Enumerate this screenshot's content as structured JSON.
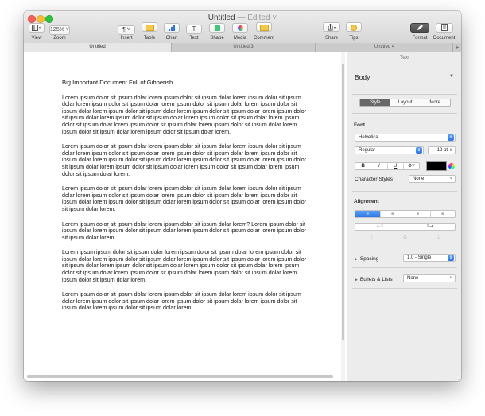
{
  "window": {
    "title": "Untitled",
    "edited_suffix": "— Edited ˅"
  },
  "toolbar": {
    "view_label": "View",
    "zoom_value": "125% ˅",
    "zoom_label": "Zoom",
    "insert_label": "Insert",
    "table_label": "Table",
    "chart_label": "Chart",
    "text_label": "Text",
    "shape_label": "Shape",
    "media_label": "Media",
    "comment_label": "Comment",
    "share_label": "Share",
    "tips_label": "Tips",
    "format_label": "Format",
    "document_label": "Document"
  },
  "tabs": [
    {
      "label": "Untitled"
    },
    {
      "label": "Untitled 3"
    },
    {
      "label": "Untitled 4"
    }
  ],
  "tab_add": "+",
  "document": {
    "heading": "Big Important Document Full of Gibberish",
    "paragraphs": [
      "Lorem ipsum dolor sit ipsum dolar lorem ipsum dolor sit ipsum dolar lorem ipsum dolor sit ipsum dolar lorem ipsum dolor sit ipsum dolar lorem ipsum dolor sit ipsum dolar lorem ipsum dolor sit ipsum dolar lorem ipsum dolor sit ipsum dolar lorem ipsum dolor sit ipsum dolar lorem ipsum dolor sit ipsum dolar lorem ipsum dolor sit ipsum dolar lorem ipsum dolor sit ipsum dolar lorem ipsum dolor sit ipsum dolar lorem ipsum dolor sit ipsum dolar lorem ipsum dolor sit ipsum dolar lorem ipsum dolor sit ipsum dolar lorem ipsum dolor sit ipsum dolar lorem.",
      "Lorem ipsum dolor sit ipsum dolar lorem ipsum dolor sit ipsum dolar lorem ipsum dolor sit ipsum dolar lorem ipsum dolor sit ipsum dolar lorem ipsum dolor sit ipsum dolar lorem ipsum dolor sit ipsum dolar lorem ipsum dolor sit ipsum dolar lorem ipsum dolor sit ipsum dolar lorem ipsum dolor sit ipsum dolar lorem ipsum dolor sit ipsum dolar lorem ipsum dolor sit ipsum dolar lorem ipsum dolor sit ipsum dolar lorem.",
      "Lorem ipsum dolor sit ipsum dolar lorem ipsum dolor sit ipsum dolar lorem ipsum dolor sit ipsum dolar lorem ipsum dolor sit ipsum dolar lorem ipsum dolor sit ipsum dolar lorem ipsum dolor sit ipsum dolar lorem ipsum dolor sit ipsum dolar lorem ipsum dolor sit ipsum dolar lorem ipsum dolor sit ipsum dolar lorem.",
      "Lorem ipsum dolor sit ipsum dolar lorem ipsum dolor sit ipsum dolar lorem? Lorem ipsum dolor sit ipsum dolar lorem ipsum dolor sit ipsum dolar lorem ipsum dolor sit ipsum dolar lorem ipsum dolor sit ipsum dolar lorem.",
      "Lorem ipsum ipsum dolor sit ipsum dolar lorem ipsum dolor sit ipsum dolar lorem ipsum dolor sit ipsum dolar lorem ipsum dolor sit ipsum dolar lorem ipsum dolor sit ipsum dolar lorem ipsum dolor sit ipsum dolar lorem ipsum dolor sit ipsum dolar lorem ipsum dolor sit ipsum dolar lorem ipsum dolor sit ipsum dolar lorem ipsum dolor sit ipsum dolar lorem ipsum dolor sit ipsum dolar lorem ipsum dolor sit ipsum dolar lorem.",
      "Lorem ipsum dolor sit ipsum dolar lorem ipsum dolor sit ipsum dolar lorem ipsum dolor sit ipsum dolar lorem ipsum dolor sit ipsum dolar lorem ipsum dolor sit ipsum dolar lorem ipsum dolor sit ipsum dolar lorem ipsum dolor sit ipsum dolar lorem."
    ]
  },
  "inspector": {
    "title": "Text",
    "paragraph_style": "Body",
    "tabs": [
      "Style",
      "Layout",
      "More"
    ],
    "font_header": "Font",
    "font_name": "Helvetica",
    "font_weight": "Regular",
    "font_size": "12 pt",
    "bold": "B",
    "italic": "I",
    "underline": "U",
    "gear": "⚙˅",
    "character_styles_label": "Character Styles",
    "character_styles_value": "None",
    "alignment_header": "Alignment",
    "spacing_label": "Spacing",
    "spacing_value": "1.0 - Single",
    "bullets_label": "Bullets & Lists",
    "bullets_value": "None"
  },
  "colors": {
    "accent": "#2d76e8",
    "close": "#fc5f57",
    "minimize": "#fdbc2e",
    "maximize": "#29c740"
  }
}
